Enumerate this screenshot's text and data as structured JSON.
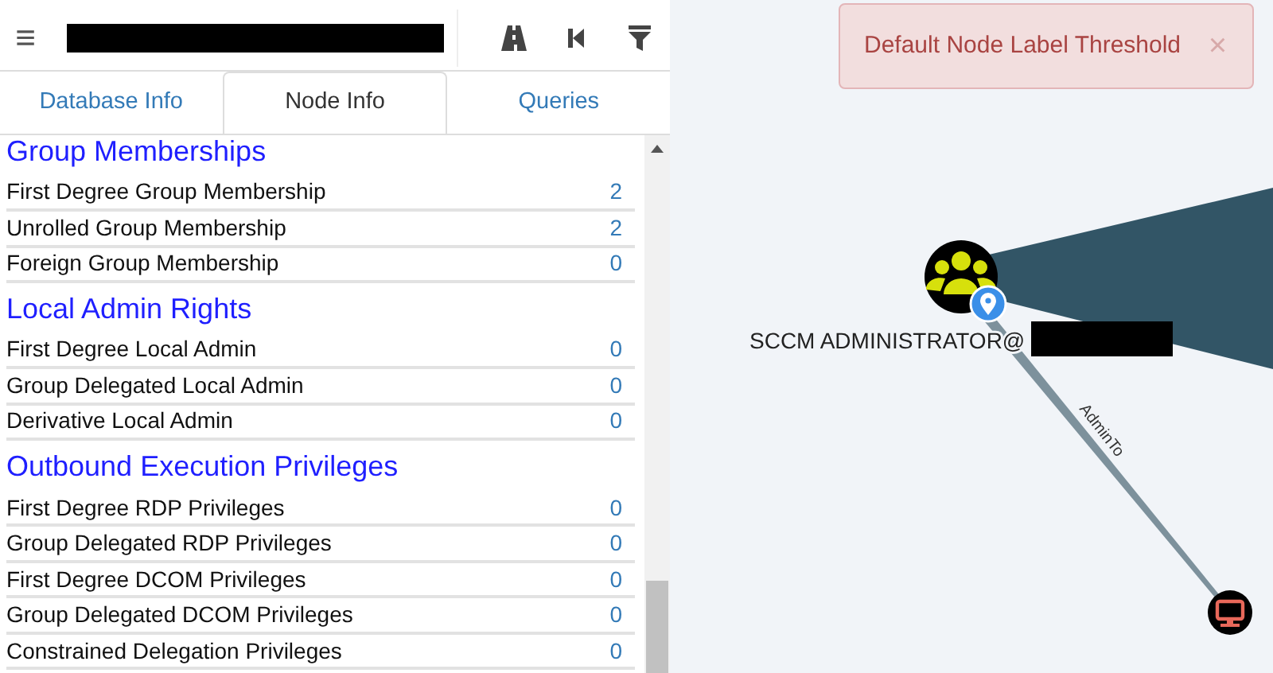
{
  "toolbar": {
    "menu": "≡"
  },
  "tabs": [
    {
      "label": "Database Info",
      "selected": false
    },
    {
      "label": "Node Info",
      "selected": true
    },
    {
      "label": "Queries",
      "selected": false
    }
  ],
  "sections": [
    {
      "title": "Group Memberships",
      "rows": [
        {
          "label": "First Degree Group Membership",
          "value": "2"
        },
        {
          "label": "Unrolled Group Membership",
          "value": "2"
        },
        {
          "label": "Foreign Group Membership",
          "value": "0"
        }
      ]
    },
    {
      "title": "Local Admin Rights",
      "rows": [
        {
          "label": "First Degree Local Admin",
          "value": "0"
        },
        {
          "label": "Group Delegated Local Admin",
          "value": "0"
        },
        {
          "label": "Derivative Local Admin",
          "value": "0"
        }
      ]
    },
    {
      "title": "Outbound Execution Privileges",
      "rows": [
        {
          "label": "First Degree RDP Privileges",
          "value": "0"
        },
        {
          "label": "Group Delegated RDP Privileges",
          "value": "0"
        },
        {
          "label": "First Degree DCOM Privileges",
          "value": "0"
        },
        {
          "label": "Group Delegated DCOM Privileges",
          "value": "0"
        },
        {
          "label": "Constrained Delegation Privileges",
          "value": "0"
        }
      ]
    }
  ],
  "alert": {
    "text": "Default Node Label Threshold",
    "close": "×"
  },
  "graph": {
    "node_label": "SCCM ADMINISTRATOR@",
    "edge_label": "AdminTo"
  }
}
